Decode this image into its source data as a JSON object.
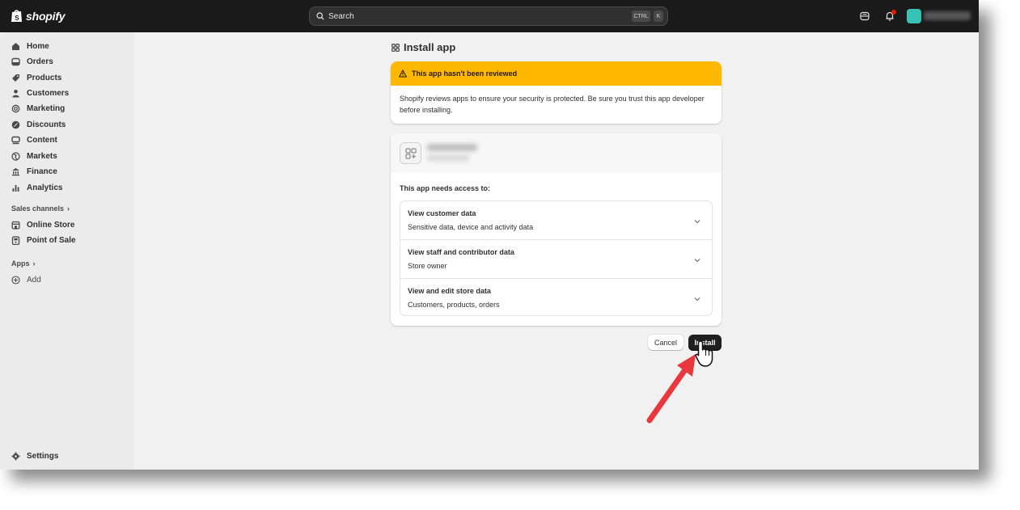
{
  "topbar": {
    "brand": "shopify",
    "search_placeholder": "Search",
    "shortcut_ctrl": "CTRL",
    "shortcut_key": "K"
  },
  "sidebar": {
    "items": [
      {
        "label": "Home",
        "icon": "home-icon"
      },
      {
        "label": "Orders",
        "icon": "orders-icon"
      },
      {
        "label": "Products",
        "icon": "tag-icon"
      },
      {
        "label": "Customers",
        "icon": "person-icon"
      },
      {
        "label": "Marketing",
        "icon": "target-icon"
      },
      {
        "label": "Discounts",
        "icon": "discount-icon"
      },
      {
        "label": "Content",
        "icon": "content-icon"
      },
      {
        "label": "Markets",
        "icon": "globe-icon"
      },
      {
        "label": "Finance",
        "icon": "bank-icon"
      },
      {
        "label": "Analytics",
        "icon": "bar-chart-icon"
      }
    ],
    "sales_channels_label": "Sales channels",
    "channels": [
      {
        "label": "Online Store",
        "icon": "store-icon"
      },
      {
        "label": "Point of Sale",
        "icon": "pos-icon"
      }
    ],
    "apps_label": "Apps",
    "add_label": "Add",
    "settings_label": "Settings"
  },
  "page": {
    "title": "Install app",
    "warning_title": "This app hasn't been reviewed",
    "warning_body": "Shopify reviews apps to ensure your security is protected. Be sure you trust this app developer before installing.",
    "needs_access": "This app needs access to:",
    "permissions": [
      {
        "title": "View customer data",
        "detail": "Sensitive data, device and activity data"
      },
      {
        "title": "View staff and contributor data",
        "detail": "Store owner"
      },
      {
        "title": "View and edit store data",
        "detail": "Customers, products, orders"
      }
    ],
    "cancel_label": "Cancel",
    "install_label": "Install"
  },
  "colors": {
    "topbar": "#1a1a1a",
    "warning": "#ffb800",
    "primary_button": "#1f1f1f",
    "annotation_arrow": "#e8383d",
    "store_avatar": "#36c2b4"
  }
}
